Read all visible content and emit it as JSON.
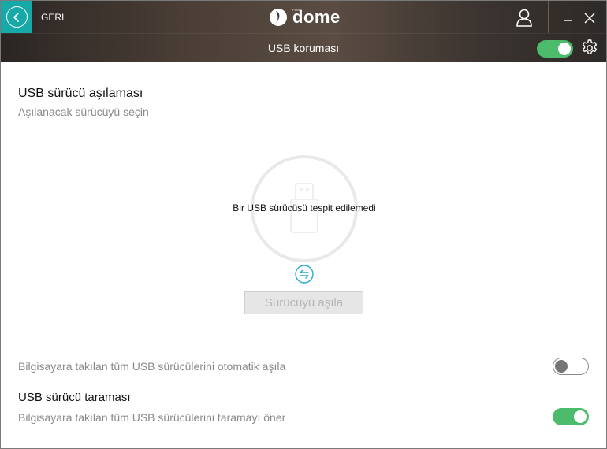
{
  "header": {
    "back_label": "GERI",
    "logo_text": "dome",
    "logo_small": "Panda",
    "section_title": "USB koruması",
    "usb_protection_enabled": true
  },
  "vaccination": {
    "title": "USB sürücü aşılaması",
    "subtitle": "Aşılanacak sürücüyü seçin",
    "empty_message": "Bir USB sürücüsü tespit edilemedi",
    "vaccinate_button": "Sürücüyü aşıla",
    "auto_vaccinate_label": "Bilgisayara takılan tüm USB sürücülerini otomatik aşıla",
    "auto_vaccinate_enabled": false
  },
  "scan": {
    "title": "USB sürücü taraması",
    "label": "Bilgisayara takılan tüm USB sürücülerini taramayı öner",
    "enabled": true
  },
  "colors": {
    "accent": "#17a9a7",
    "toggle_on": "#4cbb6c",
    "toggle_off_knob": "#757575",
    "refresh_icon": "#29a8d8"
  },
  "icons": {
    "back": "arrow-left-icon",
    "user": "user-icon",
    "minimize": "minimize-icon",
    "close": "close-icon",
    "settings": "gear-icon",
    "usb": "usb-drive-icon",
    "refresh": "refresh-arrows-icon"
  }
}
